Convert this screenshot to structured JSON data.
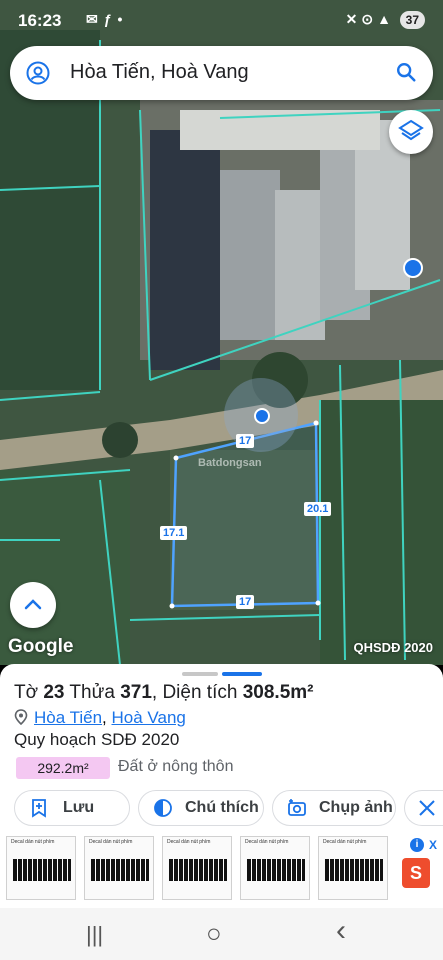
{
  "status_bar": {
    "time": "16:23",
    "battery": "37",
    "left_icons": [
      "messenger-icon",
      "facebook-icon",
      "dot-icon"
    ],
    "right_icons": [
      "mute-icon",
      "location-icon",
      "signal-4g-icon",
      "battery-icon"
    ]
  },
  "search": {
    "query": "Hòa Tiến, Hoà Vang"
  },
  "map": {
    "logo": "Google",
    "caption": "QHSDĐ 2020",
    "dimensions": {
      "top": "17",
      "right": "20.1",
      "left": "17.1",
      "bottom": "17"
    },
    "parcel_color": "#4fa3ff",
    "boundary_color": "#3fd3c0"
  },
  "sheet": {
    "sheet_prefix": "Tờ ",
    "sheet_no": "23",
    "plot_prefix": " Thửa ",
    "plot_no": "371",
    "area_prefix": ", Diện tích ",
    "area": "308.5m²",
    "address_commune": "Hòa Tiến",
    "address_sep": ", ",
    "address_district": "Hoà Vang",
    "plan_title": "Quy hoạch SDĐ 2020",
    "plan_area": "292.2m²",
    "plan_land_use": "Đất ở nông thôn",
    "actions": [
      {
        "label": "Lưu",
        "icon": "bookmark-add-icon"
      },
      {
        "label": "Chú thích",
        "icon": "legend-icon"
      },
      {
        "label": "Chụp ảnh",
        "icon": "camera-add-icon"
      }
    ]
  },
  "ads": {
    "items": [
      {
        "title": "Decal dán nút phím"
      },
      {
        "title": "Decal dán nút phím"
      },
      {
        "title": "Decal dán nút phím"
      },
      {
        "title": "Decal dán nút phím"
      },
      {
        "title": "Decal dán nút phím"
      }
    ],
    "info": "i",
    "close": "X"
  },
  "nav": {
    "recents": "|||",
    "home": "○",
    "back": "‹"
  }
}
